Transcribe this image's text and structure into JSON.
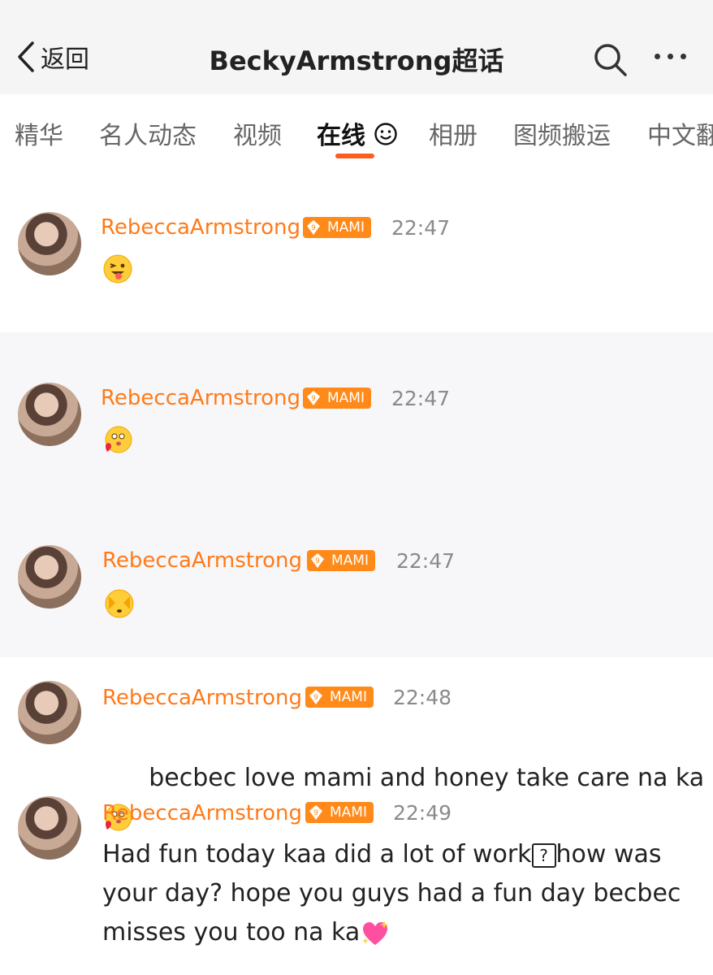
{
  "header": {
    "back_label": "返回",
    "title": "BeckyArmstrong超话"
  },
  "tabs": [
    {
      "label": "精华"
    },
    {
      "label": "名人动态"
    },
    {
      "label": "视频"
    },
    {
      "label": "在线"
    },
    {
      "label": "相册"
    },
    {
      "label": "图频搬运"
    },
    {
      "label": "中文翻"
    }
  ],
  "messages": [
    {
      "name": "RebeccaArmstrong",
      "badge": "MAMI",
      "time": "22:47",
      "emoji": "wink-tongue-emoji"
    },
    {
      "name": "RebeccaArmstrong",
      "badge": "MAMI",
      "time": "22:47",
      "emoji": "hug-heart-emoji"
    },
    {
      "name": "RebeccaArmstrong",
      "badge": "MAMI",
      "time": "22:47",
      "emoji": "shy-emoji"
    },
    {
      "name": "RebeccaArmstrong",
      "badge": "MAMI",
      "time": "22:48",
      "text": "becbec love mami and honey take care na ka",
      "emoji": "hug-heart-emoji"
    },
    {
      "name": "RebeccaArmstrong",
      "badge": "MAMI",
      "time": "22:49",
      "text_line1": "Had fun today kaa did a lot of work",
      "unknown_char": "?",
      "text_line1b": "how was",
      "text_line2": "your day? hope you guys had a fun day becbec",
      "text_line3": "misses you too na ka",
      "emoji": "sparkling-heart-emoji"
    }
  ],
  "colors": {
    "accent": "#ff5b1f",
    "name": "#ff7a1a",
    "badge": "#ff8a1a"
  }
}
